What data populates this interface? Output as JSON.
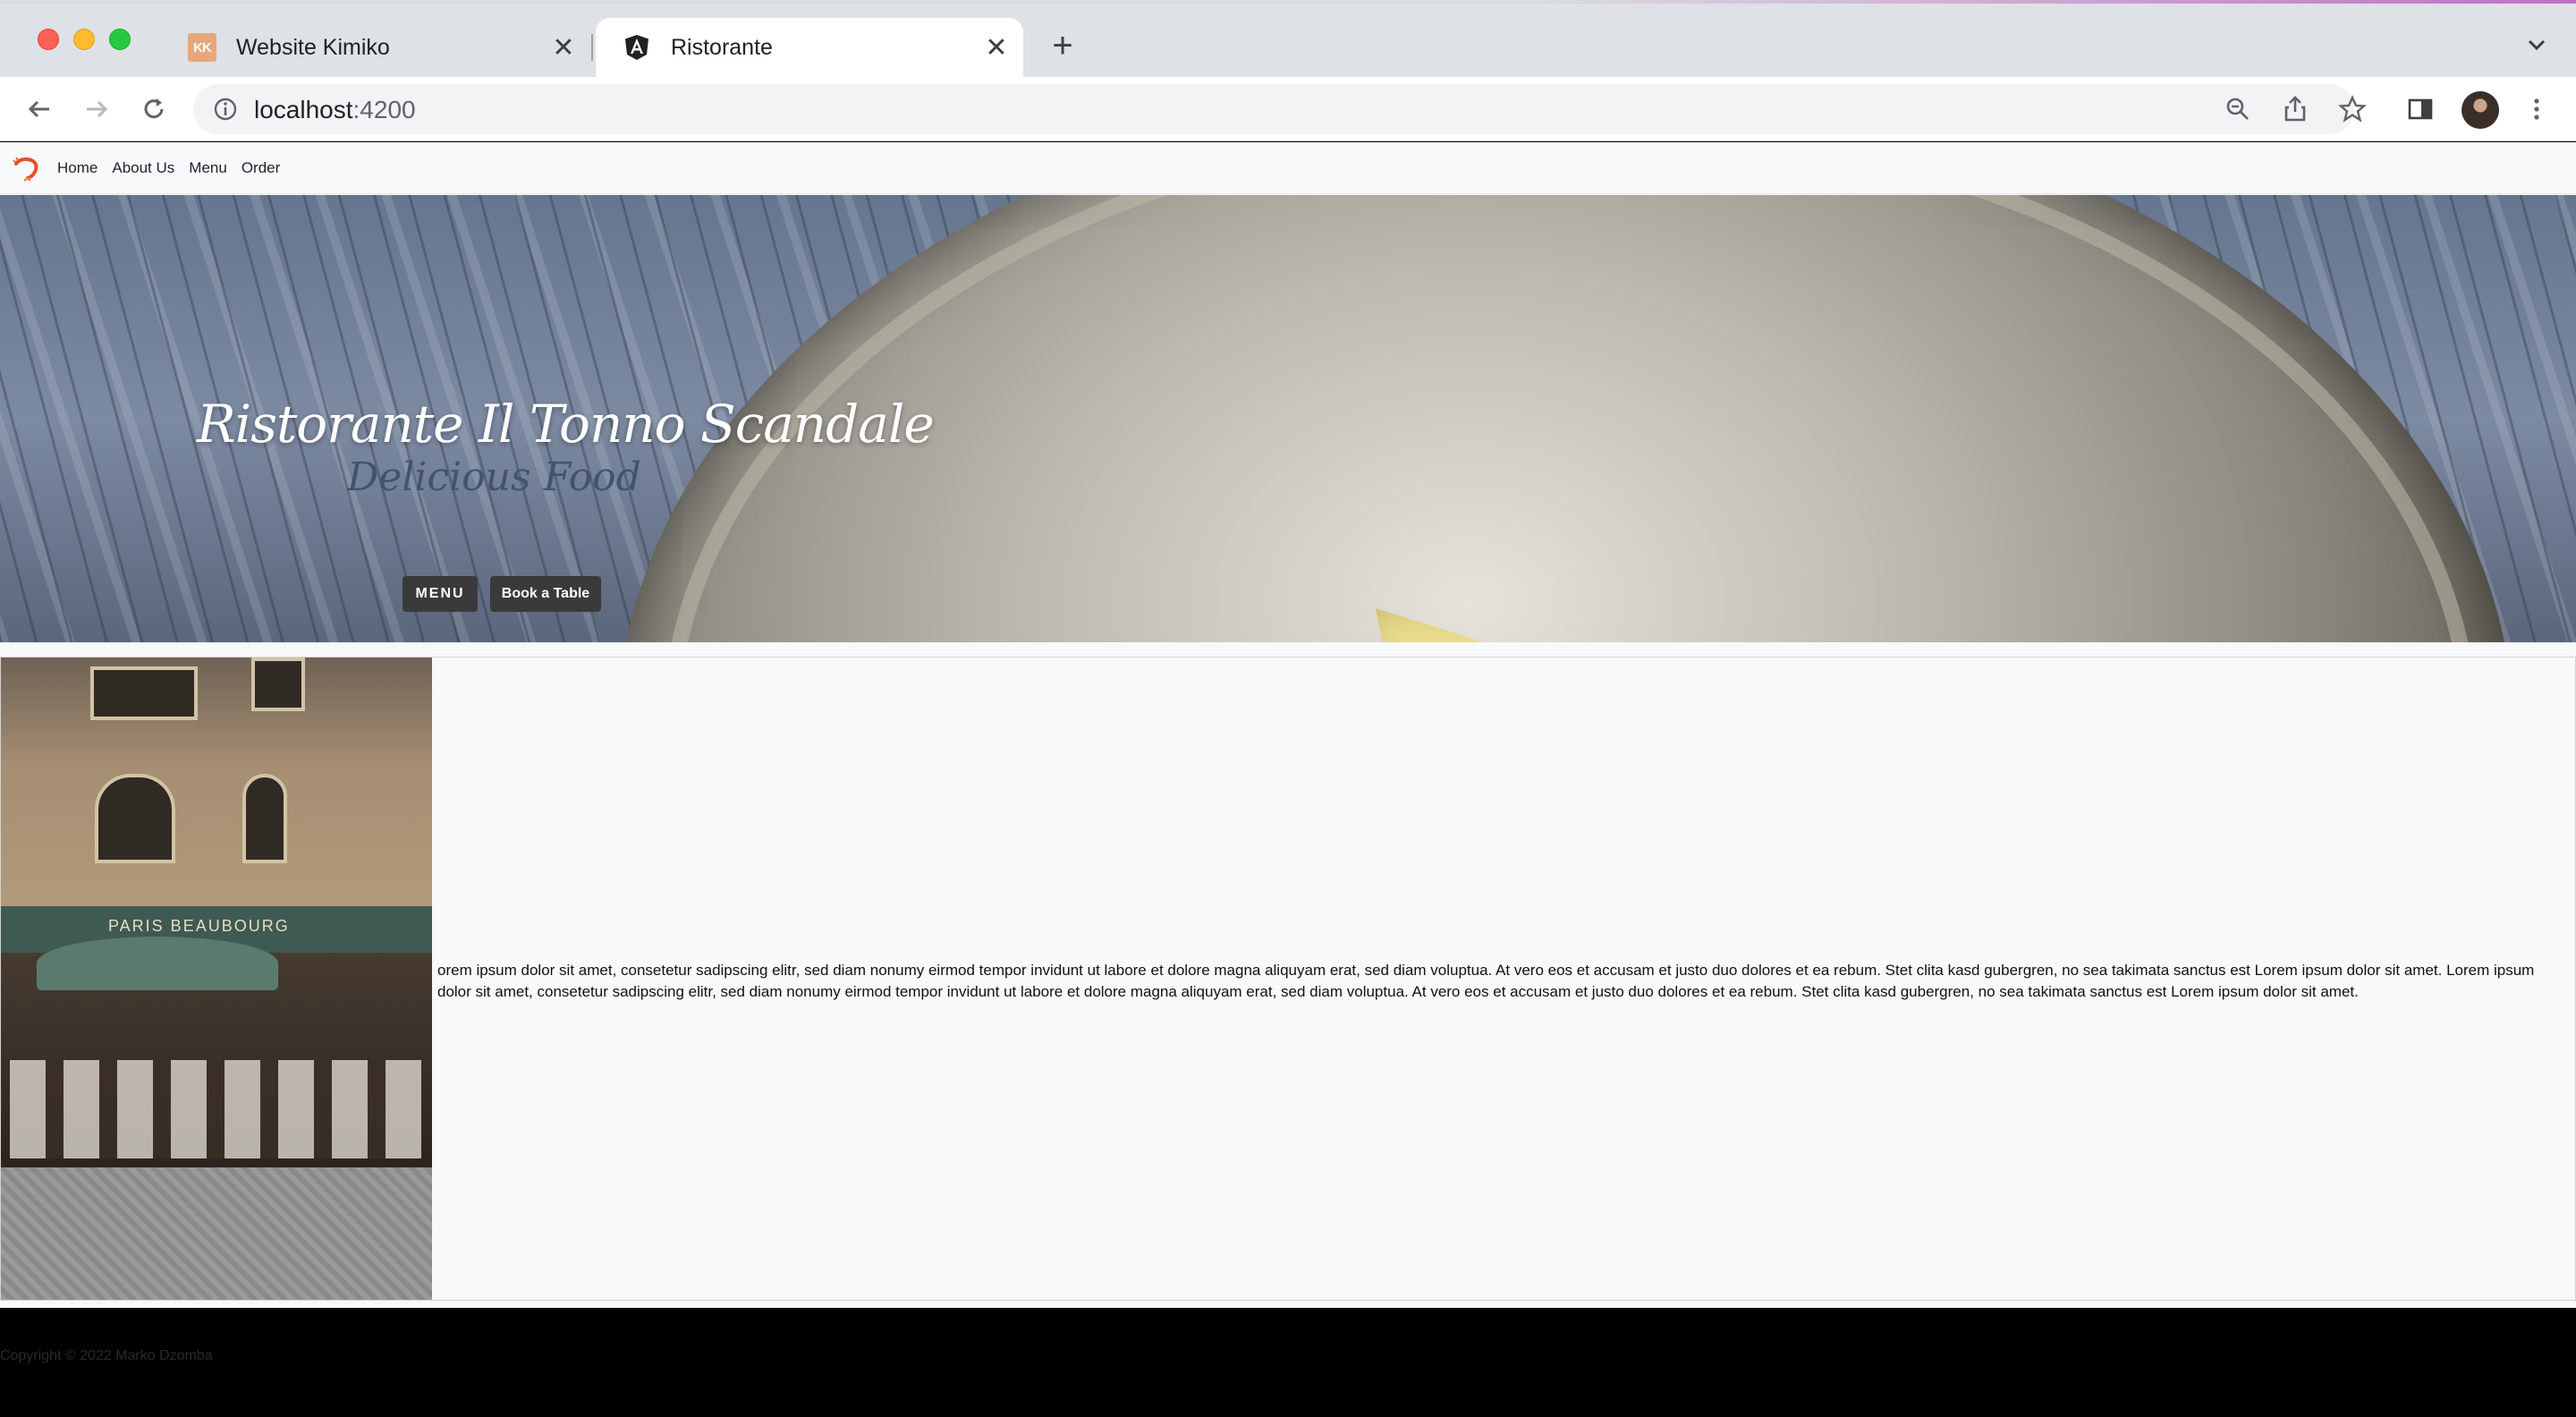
{
  "browser": {
    "tabs": [
      {
        "title": "Website Kimiko",
        "favicon": "kk-icon",
        "favicon_text": "KK",
        "active": false
      },
      {
        "title": "Ristorante",
        "favicon": "angular-icon",
        "active": true
      }
    ],
    "address": {
      "host": "localhost",
      "port": ":4200"
    }
  },
  "navbar": {
    "links": [
      "Home",
      "About Us",
      "Menu",
      "Order"
    ]
  },
  "hero": {
    "title": "Ristorante Il Tonno Scandale",
    "subtitle": "Delicious Food",
    "menu_button": "MENU",
    "book_button": "Book a Table"
  },
  "about": {
    "text": "orem ipsum dolor sit amet, consetetur sadipscing elitr, sed diam nonumy eirmod tempor invidunt ut labore et dolore magna aliquyam erat, sed diam voluptua. At vero eos et accusam et justo duo dolores et ea rebum. Stet clita kasd gubergren, no sea takimata sanctus est Lorem ipsum dolor sit amet. Lorem ipsum dolor sit amet, consetetur sadipscing elitr, sed diam nonumy eirmod tempor invidunt ut labore et dolore magna aliquyam erat, sed diam voluptua. At vero eos et accusam et justo duo dolores et ea rebum. Stet clita kasd gubergren, no sea takimata sanctus est Lorem ipsum dolor sit amet."
  },
  "footer": {
    "copyright": "Copyright © 2022 Marko Dzomba"
  },
  "colors": {
    "tabstrip": "#dee1e6",
    "hero_button": "#3a3a3a",
    "footer": "#000000",
    "page_bg": "#f8f9fa"
  }
}
